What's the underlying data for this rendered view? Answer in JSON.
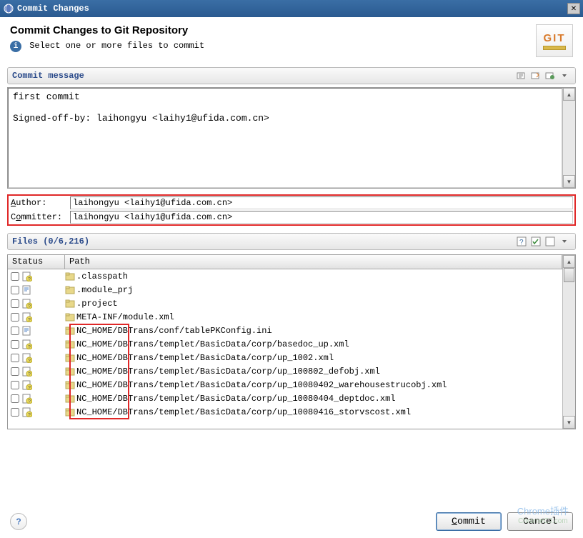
{
  "window_title": "Commit Changes",
  "header": {
    "title": "Commit Changes to Git Repository",
    "subtitle": "Select one or more files to commit",
    "logo_text": "GIT"
  },
  "commit_message": {
    "label": "Commit message",
    "text": "first commit\n\nSigned-off-by: laihongyu <laihy1@ufida.com.cn>"
  },
  "author": {
    "label_author": "Author:",
    "label_committer": "Committer:",
    "author_value": "laihongyu <laihy1@ufida.com.cn>",
    "committer_value": "laihongyu <laihy1@ufida.com.cn>"
  },
  "files": {
    "label": "Files (0/6,216)",
    "columns": {
      "status": "Status",
      "path": "Path"
    },
    "rows": [
      {
        "path": ".classpath",
        "icon": "question"
      },
      {
        "path": ".module_prj",
        "icon": "doc"
      },
      {
        "path": ".project",
        "icon": "question"
      },
      {
        "path": "META-INF/module.xml",
        "icon": "question"
      },
      {
        "path": "NC_HOME/DBTrans/conf/tablePKConfig.ini",
        "icon": "doc"
      },
      {
        "path": "NC_HOME/DBTrans/templet/BasicData/corp/basedoc_up.xml",
        "icon": "question"
      },
      {
        "path": "NC_HOME/DBTrans/templet/BasicData/corp/up_1002.xml",
        "icon": "question"
      },
      {
        "path": "NC_HOME/DBTrans/templet/BasicData/corp/up_100802_defobj.xml",
        "icon": "question"
      },
      {
        "path": "NC_HOME/DBTrans/templet/BasicData/corp/up_10080402_warehousestrucobj.xml",
        "icon": "question"
      },
      {
        "path": "NC_HOME/DBTrans/templet/BasicData/corp/up_10080404_deptdoc.xml",
        "icon": "question"
      },
      {
        "path": "NC_HOME/DBTrans/templet/BasicData/corp/up_10080416_storvscost.xml",
        "icon": "question"
      }
    ]
  },
  "footer": {
    "commit": "Commit",
    "cancel": "Cancel"
  },
  "watermark": {
    "line1": "Chrome插件",
    "line2": "ChromeCJ.com"
  }
}
